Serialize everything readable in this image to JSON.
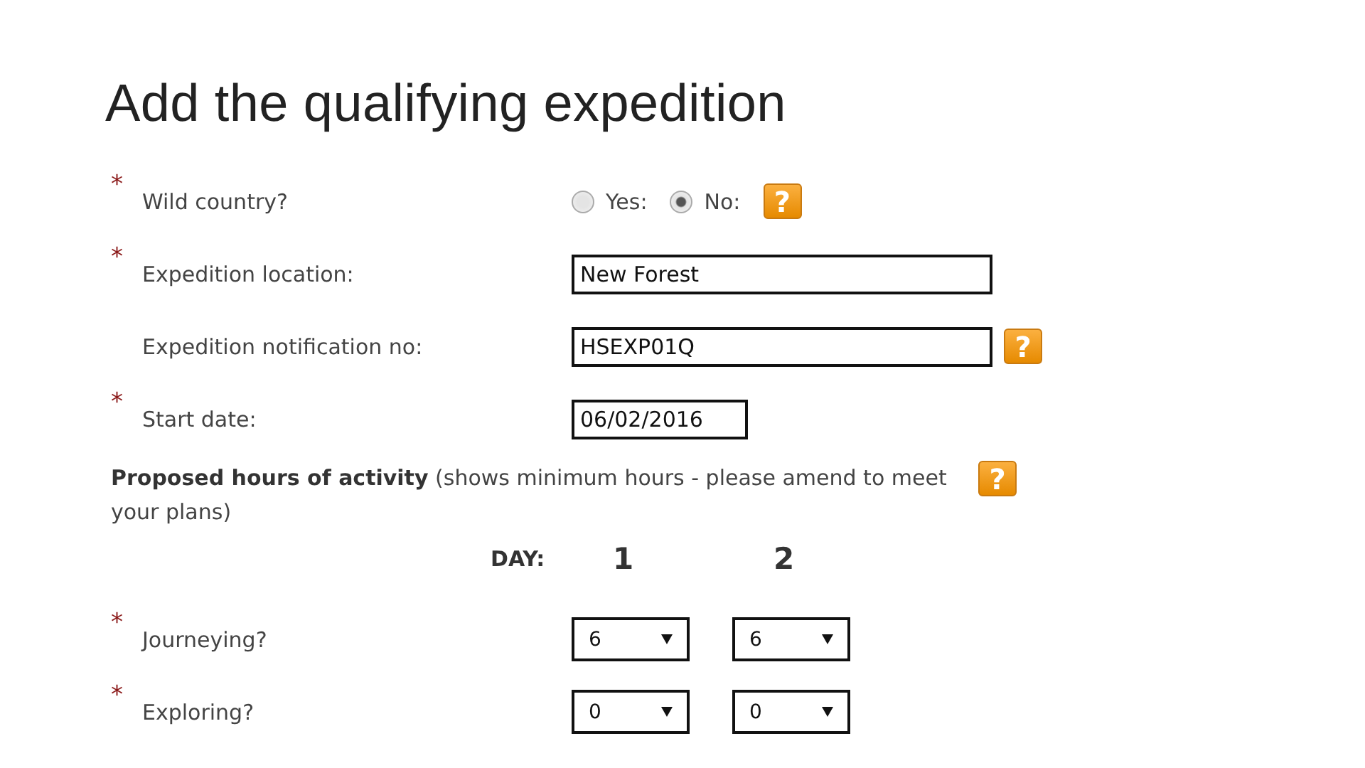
{
  "title": "Add the qualifying expedition",
  "wild_country": {
    "required_mark": "*",
    "label": "Wild country?",
    "options": [
      {
        "label": "Yes:",
        "selected": false
      },
      {
        "label": "No:",
        "selected": true
      }
    ],
    "help": "?"
  },
  "fields": [
    {
      "required_mark": "*",
      "label": "Expedition location:",
      "value": "New Forest",
      "kind": "long"
    },
    {
      "label": "Expedition notification no:",
      "value": "HSEXP01Q",
      "kind": "long",
      "help": "?"
    },
    {
      "required_mark": "*",
      "label": "Start date:",
      "value": "06/02/2016",
      "kind": "short"
    }
  ],
  "hours": {
    "heading": "**Proposed hours of activity** (shows minimum hours - please amend to meet your plans)",
    "help": "?",
    "day_label": "DAY:",
    "days": [
      "1",
      "2"
    ],
    "rows": [
      {
        "required_mark": "*",
        "label": "Journeying?",
        "values": [
          "6",
          "6"
        ]
      },
      {
        "required_mark": "*",
        "label": "Exploring?",
        "values": [
          "0",
          "0"
        ]
      }
    ]
  }
}
